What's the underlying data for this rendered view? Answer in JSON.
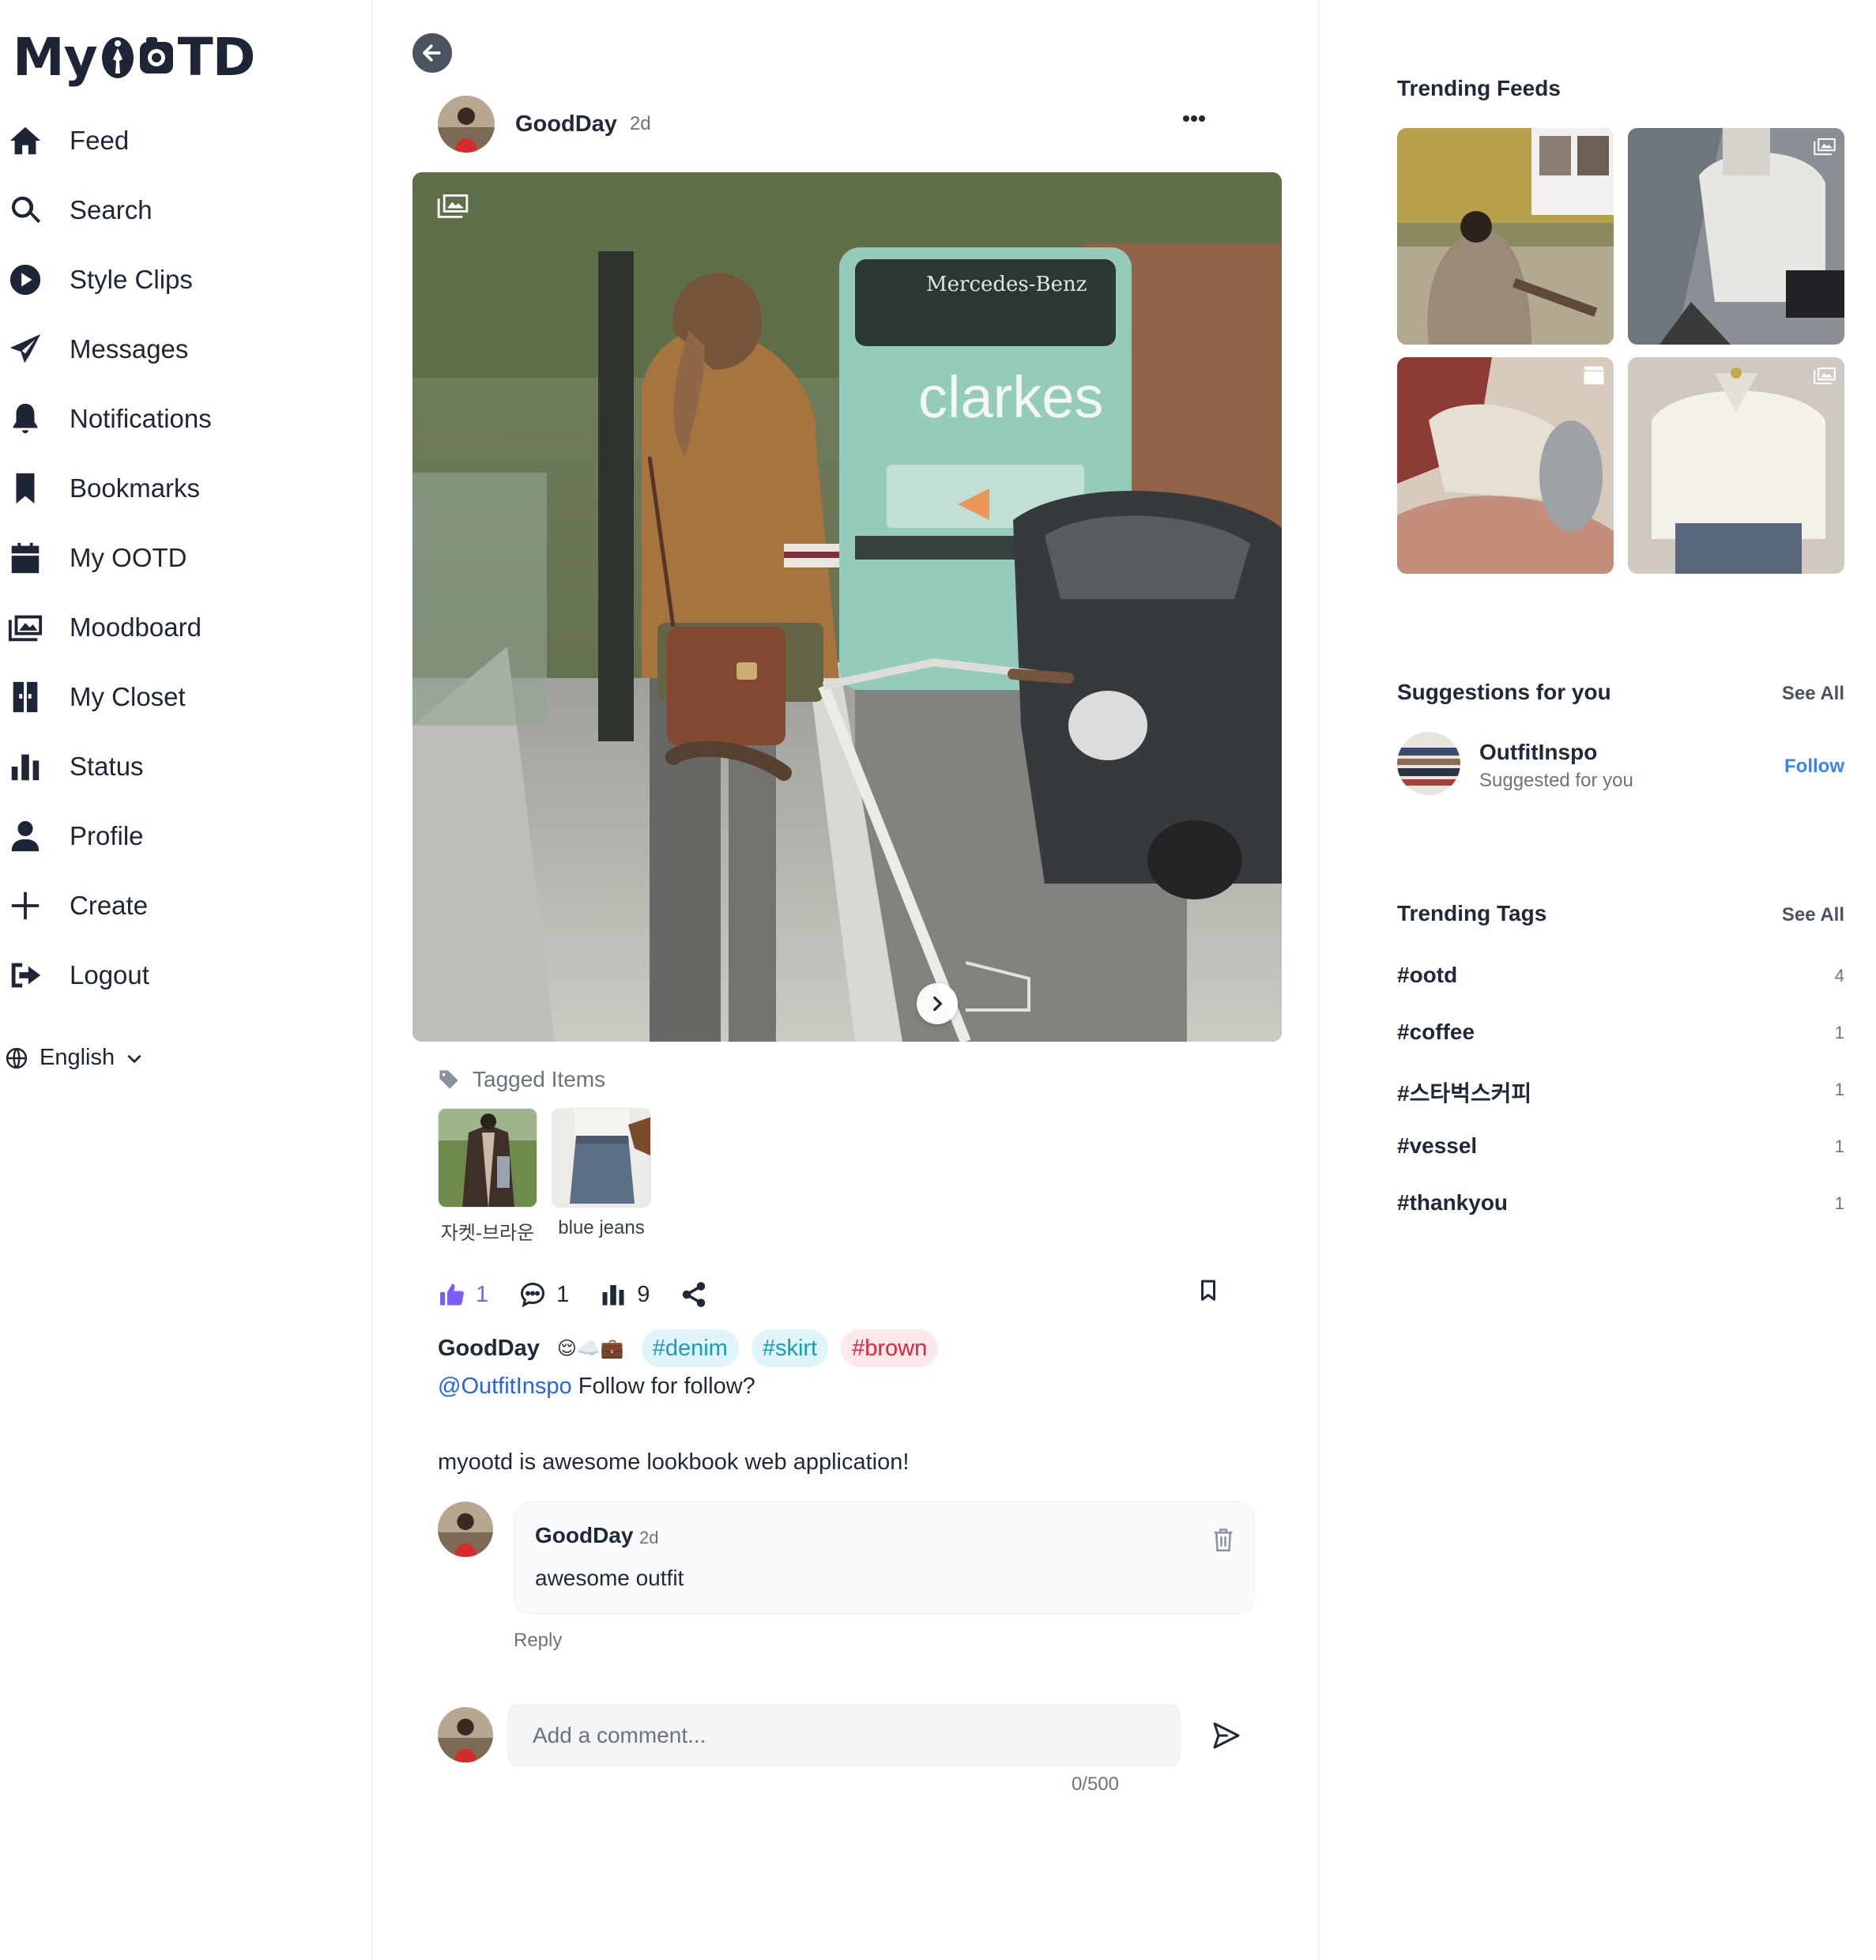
{
  "app": {
    "logo_left": "My",
    "logo_right": "TD"
  },
  "sidebar": {
    "items": [
      {
        "label": "Feed",
        "icon": "home-icon"
      },
      {
        "label": "Search",
        "icon": "search-icon"
      },
      {
        "label": "Style Clips",
        "icon": "play-circle-icon"
      },
      {
        "label": "Messages",
        "icon": "paper-plane-icon"
      },
      {
        "label": "Notifications",
        "icon": "bell-icon"
      },
      {
        "label": "Bookmarks",
        "icon": "bookmark-icon"
      },
      {
        "label": "My OOTD",
        "icon": "calendar-icon"
      },
      {
        "label": "Moodboard",
        "icon": "images-icon"
      },
      {
        "label": "My Closet",
        "icon": "closet-icon"
      },
      {
        "label": "Status",
        "icon": "bar-chart-icon"
      },
      {
        "label": "Profile",
        "icon": "user-icon"
      },
      {
        "label": "Create",
        "icon": "plus-icon"
      },
      {
        "label": "Logout",
        "icon": "logout-icon"
      }
    ],
    "language": "English"
  },
  "post": {
    "author": "GoodDay",
    "time": "2d",
    "tagged_title": "Tagged Items",
    "tagged_items": [
      {
        "label": "자켓-브라운"
      },
      {
        "label": "blue jeans"
      }
    ],
    "likes": "1",
    "comments": "1",
    "views": "9",
    "caption": {
      "author": "GoodDay",
      "emoji": "😌☁️💼",
      "hashtags": [
        {
          "text": "#denim",
          "bg": "#e0f5fb",
          "color": "#1a9bb5"
        },
        {
          "text": "#skirt",
          "bg": "#e0f5fb",
          "color": "#1a9bb5"
        },
        {
          "text": "#brown",
          "bg": "#fde8ea",
          "color": "#dc2640"
        }
      ],
      "mention": "@OutfitInspo",
      "mention_rest": " Follow for follow?",
      "body": "myootd is awesome lookbook web application!"
    },
    "comment": {
      "author": "GoodDay",
      "time": "2d",
      "text": "awesome outfit",
      "reply": "Reply"
    },
    "add_comment": {
      "placeholder": "Add a comment...",
      "count": "0/500"
    }
  },
  "right": {
    "trending_feeds_title": "Trending Feeds",
    "suggestions_title": "Suggestions for you",
    "see_all": "See All",
    "suggestion": {
      "name": "OutfitInspo",
      "sub": "Suggested for you",
      "follow": "Follow"
    },
    "trending_tags_title": "Trending Tags",
    "tags": [
      {
        "name": "#ootd",
        "count": "4"
      },
      {
        "name": "#coffee",
        "count": "1"
      },
      {
        "name": "#스타벅스커피",
        "count": "1"
      },
      {
        "name": "#vessel",
        "count": "1"
      },
      {
        "name": "#thankyou",
        "count": "1"
      }
    ]
  },
  "colors": {
    "like_accent": "#7c5cff",
    "follow_blue": "#3b82f6",
    "mention_blue": "#2563eb",
    "nav_text": "#1e2536"
  }
}
